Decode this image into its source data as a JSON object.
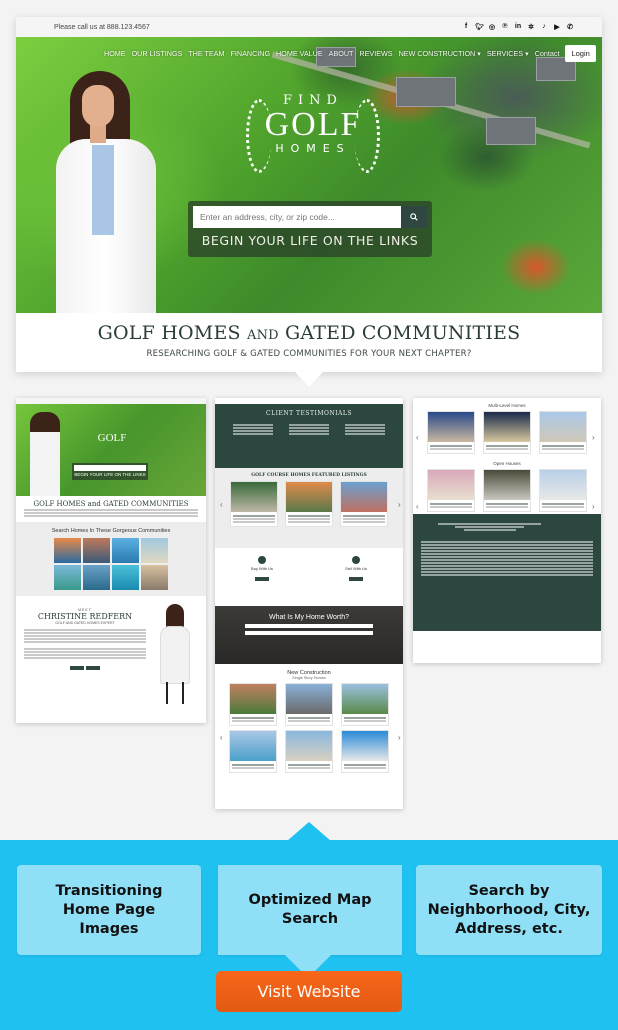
{
  "site": {
    "topbar": {
      "phone_text": "Please call us at 888.123.4567",
      "social_icons": [
        "facebook-icon",
        "twitter-icon",
        "instagram-icon",
        "pinterest-icon",
        "linkedin-icon",
        "yelp-icon",
        "tiktok-icon",
        "youtube-icon",
        "whatsapp-icon"
      ]
    },
    "nav": {
      "items": [
        {
          "label": "HOME"
        },
        {
          "label": "OUR LISTINGS"
        },
        {
          "label": "THE TEAM"
        },
        {
          "label": "FINANCING"
        },
        {
          "label": "HOME VALUE"
        },
        {
          "label": "ABOUT"
        },
        {
          "label": "REVIEWS"
        },
        {
          "label": "NEW CONSTRUCTION ▾"
        },
        {
          "label": "SERVICES ▾"
        },
        {
          "label": "Contact"
        }
      ],
      "login_label": "Login"
    },
    "logo": {
      "find": "FIND",
      "golf": "GOLF",
      "homes": "HOMES"
    },
    "search": {
      "placeholder": "Enter an address, city, or zip code...",
      "button_icon": "search-icon"
    },
    "tagline": "BEGIN YOUR LIFE ON THE LINKS",
    "headline": {
      "title_a": "GOLF HOMES ",
      "title_and": "AND",
      "title_b": " GATED COMMUNITIES",
      "subtitle": "RESEARCHING GOLF & GATED COMMUNITIES FOR YOUR NEXT CHAPTER?"
    }
  },
  "previews": {
    "home": {
      "headline": "GOLF HOMES and GATED COMMUNITIES",
      "tagline": "BEGIN YOUR LIFE ON THE LINKS",
      "communities_title": "Search Homes In These Gorgeous Communities",
      "meet_label": "MEET",
      "agent_name": "CHRISTINE REDFERN",
      "agent_title": "GOLF AND GATED HOMES EXPERT"
    },
    "middle": {
      "testimonials_title": "CLIENT TESTIMONIALS",
      "featured_title": "GOLF COURSE HOMES FEATURED LISTINGS",
      "buy_label": "Buy With Us",
      "sell_label": "Sell With Us",
      "worth_title": "What Is My Home Worth?",
      "new_construction_title": "New Construction",
      "new_construction_sub": "Single Story Homes"
    },
    "right": {
      "multi_level_title": "Multi-Level Homes",
      "open_houses_title": "Open Houses"
    }
  },
  "features": [
    {
      "label": "Transitioning Home Page Images"
    },
    {
      "label": "Optimized Map Search"
    },
    {
      "label": "Search by Neighborhood, City, Address, etc."
    }
  ],
  "cta": {
    "label": "Visit Website"
  },
  "colors": {
    "brand_dark_green": "#2c4640",
    "band_blue": "#1fc1f1",
    "feature_blue": "#8fe0f7",
    "cta_orange": "#f25f16"
  }
}
